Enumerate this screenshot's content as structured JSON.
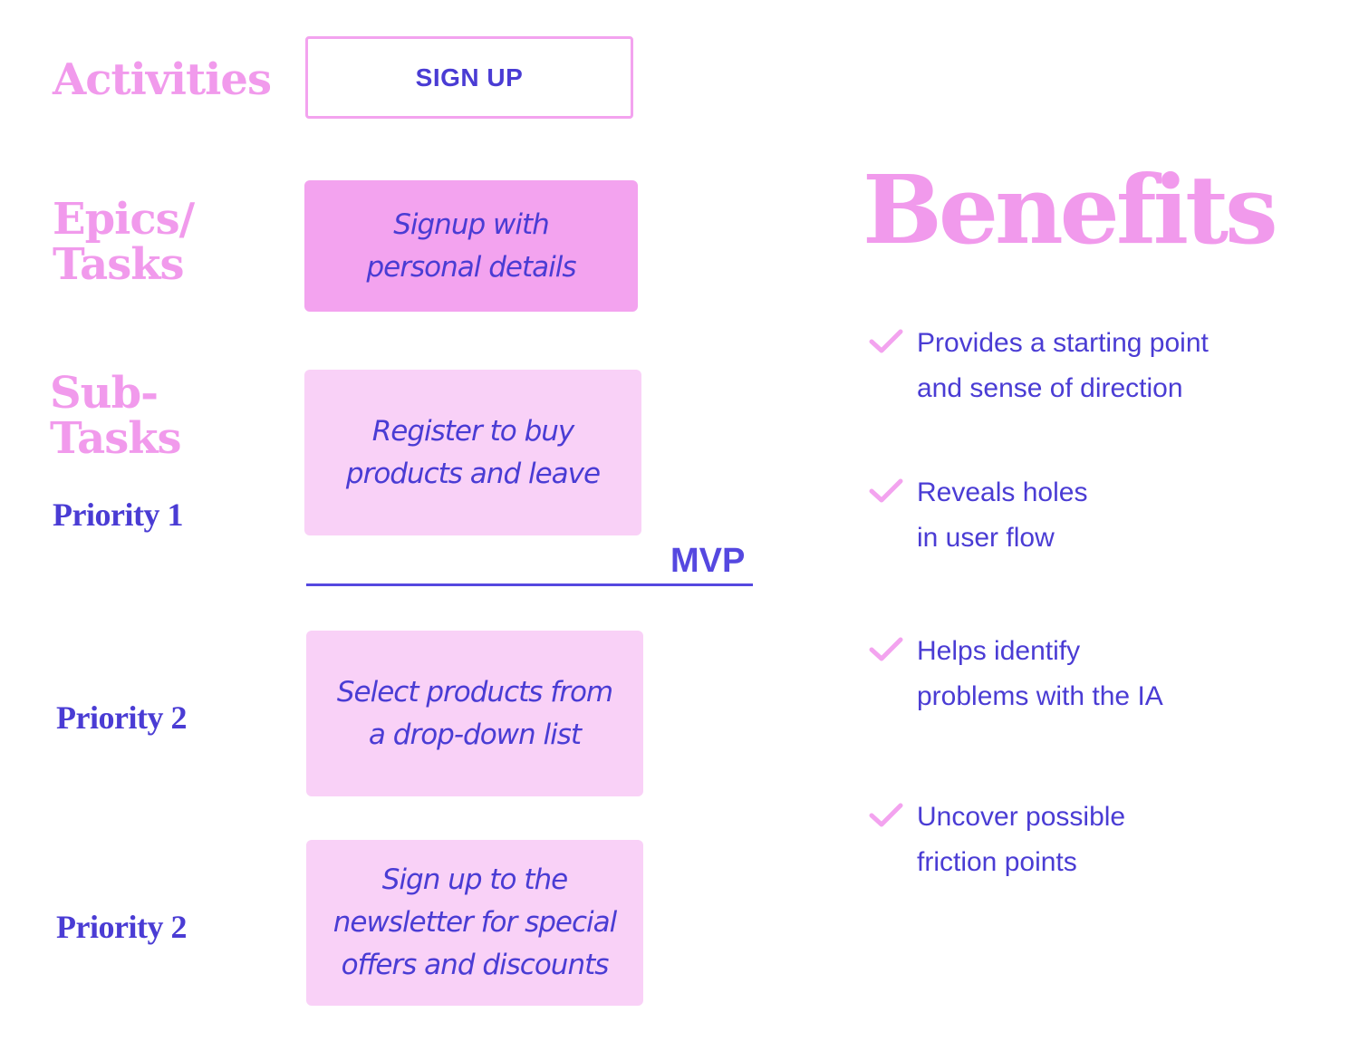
{
  "colors": {
    "pink_heading": "#f19aec",
    "indigo_text": "#4a3cd4",
    "epic_card": "#f3a3ef",
    "subtask_card": "#f9d1f7",
    "mvp_line": "#5548e0"
  },
  "left_labels": {
    "activities": "Activities",
    "epics_line1": "Epics/",
    "epics_line2": "Tasks",
    "subtasks_line1": "Sub-",
    "subtasks_line2": "Tasks",
    "priorities": [
      "Priority 1",
      "Priority 2",
      "Priority 2"
    ]
  },
  "activity": {
    "label": "SIGN UP"
  },
  "epic": {
    "text": "Signup with\npersonal details"
  },
  "subtasks": [
    {
      "priority": "Priority 1",
      "text": "Register to buy\nproducts and leave"
    },
    {
      "priority": "Priority 2",
      "text": "Select products from\na drop-down list"
    },
    {
      "priority": "Priority 2",
      "text": "Sign up to the\nnewsletter for special\noffers and discounts"
    }
  ],
  "mvp": {
    "label": "MVP"
  },
  "benefits": {
    "title": "Benefits",
    "items": [
      {
        "icon": "checkmark-icon",
        "text": "Provides a starting point\nand sense of direction"
      },
      {
        "icon": "checkmark-icon",
        "text": "Reveals holes\nin user flow"
      },
      {
        "icon": "checkmark-icon",
        "text": "Helps identify\nproblems with the IA"
      },
      {
        "icon": "checkmark-icon",
        "text": "Uncover possible\nfriction points"
      }
    ]
  }
}
